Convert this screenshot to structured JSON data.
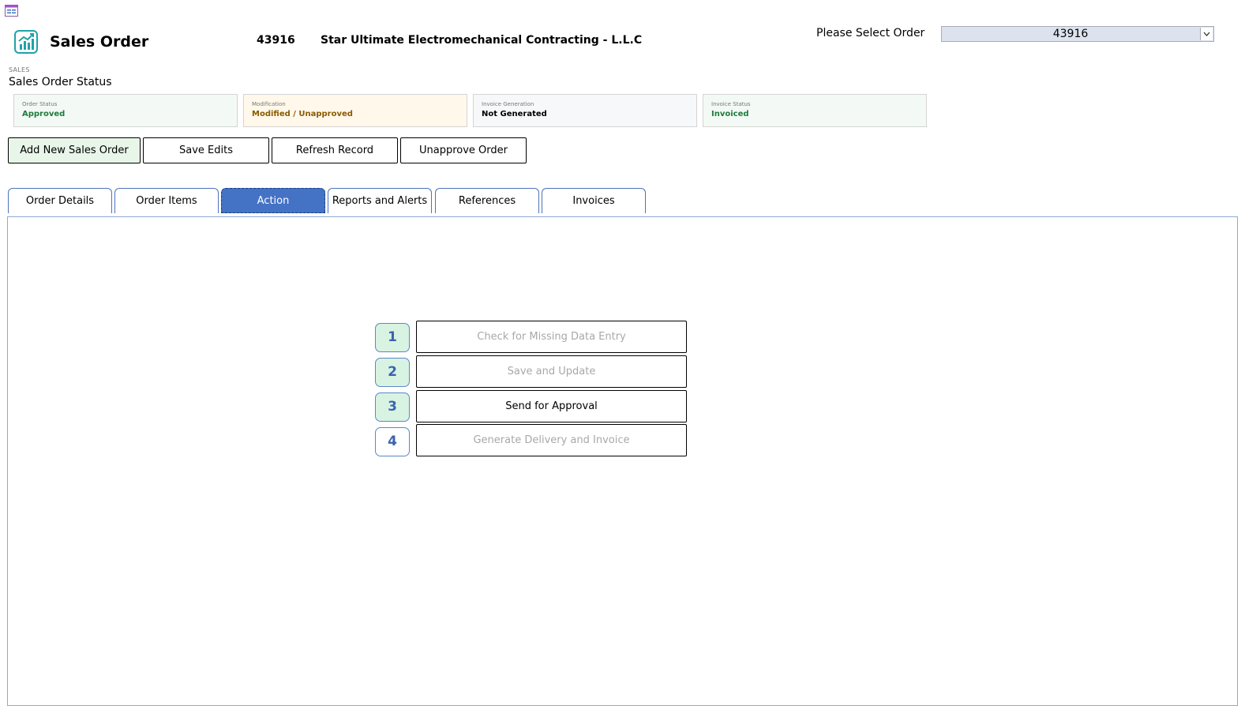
{
  "header": {
    "title": "Sales Order",
    "order_number": "43916",
    "customer_name": "Star Ultimate Electromechanical Contracting - L.L.C",
    "select_label": "Please Select Order",
    "selected_order": "43916"
  },
  "section": {
    "small_label": "SALES",
    "title": "Sales Order Status"
  },
  "status_cards": [
    {
      "label": "Order Status",
      "value": "Approved",
      "value_color": "#1e7b3d",
      "bg": "#f3f9f4"
    },
    {
      "label": "Modification",
      "value": "Modified / Unapproved",
      "value_color": "#8b5a00",
      "bg": "#fff8eb"
    },
    {
      "label": "Invoice Generation",
      "value": "Not Generated",
      "value_color": "#000000",
      "bg": "#f7f8fa"
    },
    {
      "label": "Invoice Status",
      "value": "Invoiced",
      "value_color": "#1e7b3d",
      "bg": "#f3f9f4"
    }
  ],
  "toolbar": {
    "add_label": "Add New Sales Order",
    "save_label": "Save Edits",
    "refresh_label": "Refresh Record",
    "unapprove_label": "Unapprove Order"
  },
  "tabs": [
    {
      "label": "Order Details"
    },
    {
      "label": "Order Items"
    },
    {
      "label": "Action",
      "active": true
    },
    {
      "label": "Reports and Alerts"
    },
    {
      "label": "References"
    },
    {
      "label": "Invoices"
    }
  ],
  "steps": [
    {
      "number": "1",
      "label": "Check for Missing Data Entry",
      "enabled": false
    },
    {
      "number": "2",
      "label": "Save and Update",
      "enabled": false
    },
    {
      "number": "3",
      "label": "Send for Approval",
      "enabled": true
    },
    {
      "number": "4",
      "label": "Generate Delivery and Invoice",
      "enabled": false
    }
  ],
  "colors": {
    "accent": "#4472c4",
    "step_fill": "#d8f3e2",
    "add_button_bg": "#e8f5e9"
  },
  "icons": {
    "form": "form-icon",
    "app": "chart-growth-icon",
    "dropdown": "chevron-down-icon"
  }
}
